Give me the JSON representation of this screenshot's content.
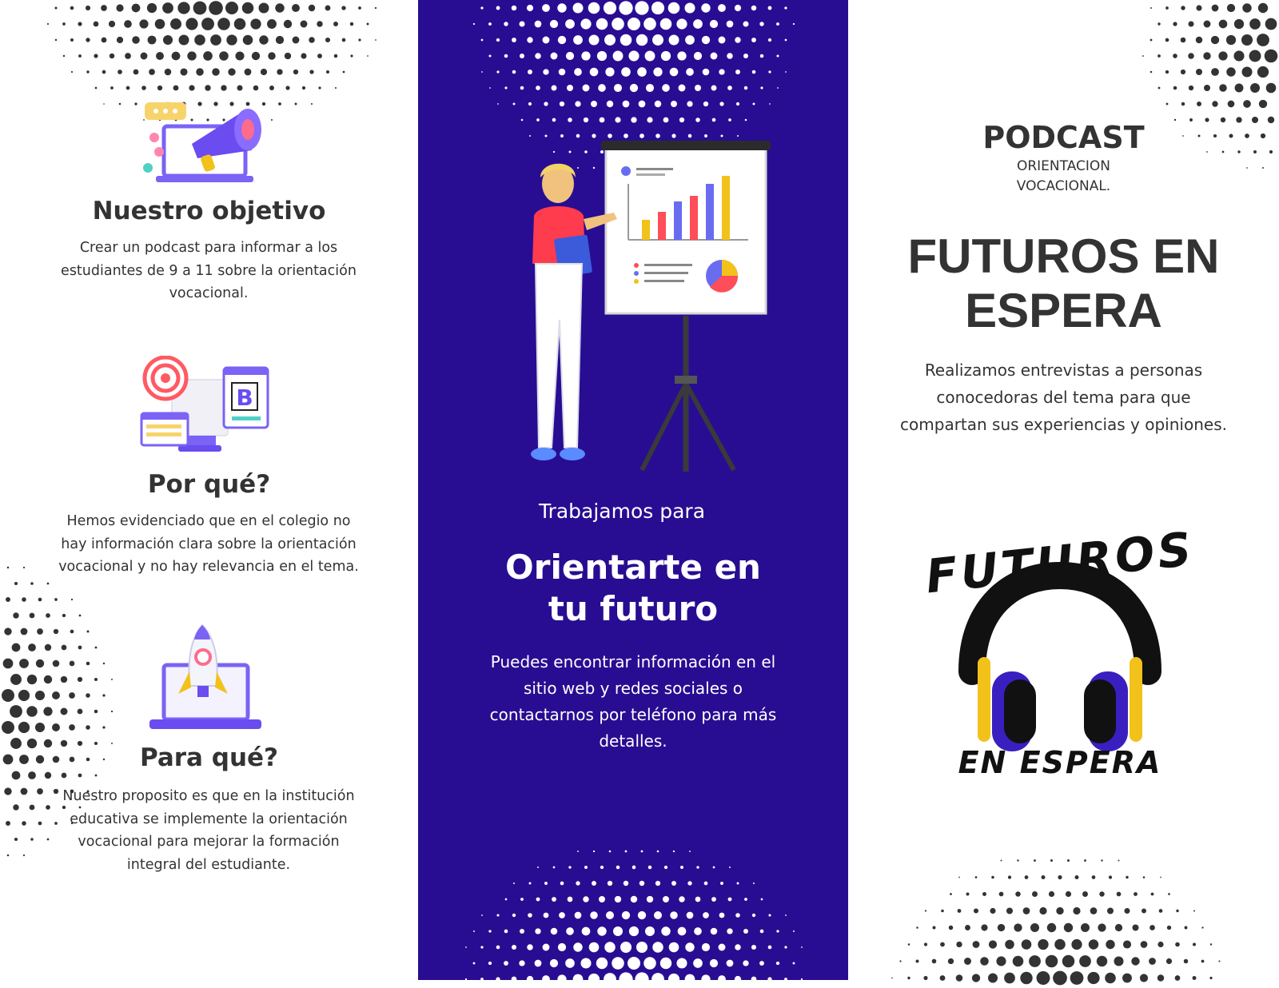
{
  "left_panel": {
    "sections": [
      {
        "title": "Nuestro objetivo",
        "body": "Crear un podcast para informar a los estudiantes de 9 a 11 sobre la orientación vocacional.",
        "icon": "megaphone-laptop-icon"
      },
      {
        "title": "Por qué?",
        "body": "Hemos evidenciado que en el colegio no hay información clara sobre la orientación vocacional y no hay relevancia en el tema.",
        "icon": "target-design-screens-icon"
      },
      {
        "title": "Para qué?",
        "body": "Nuestro proposito es que en la institución educativa se implemente la orientación vocacional para mejorar la formación integral del estudiante.",
        "icon": "rocket-laptop-icon"
      }
    ]
  },
  "center_panel": {
    "kicker": "Trabajamos para",
    "headline": "Orientarte en tu futuro",
    "body": "Puedes encontrar información en el sitio web y redes sociales o contactarnos por teléfono para más detalles.",
    "illustration": "presenter-whiteboard-illustration"
  },
  "right_panel": {
    "label": "PODCAST",
    "sublabel": "ORIENTACION VOCACIONAL.",
    "title": "FUTUROS EN ESPERA",
    "description": "Realizamos entrevistas a personas conocedoras del tema para que compartan sus experiencias y opiniones.",
    "logo": {
      "top_text": "FUTUROS",
      "bottom_text": "EN ESPERA",
      "icon": "headphones-icon"
    }
  },
  "colors": {
    "center_background": "#280d92",
    "text_dark": "#333333",
    "dots": "#333333",
    "accent_purple": "#6a4cf0",
    "accent_yellow": "#f2c21b"
  }
}
